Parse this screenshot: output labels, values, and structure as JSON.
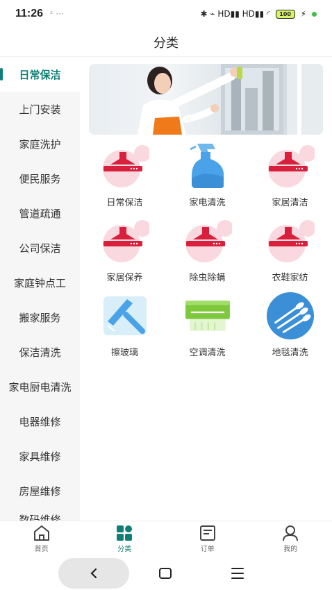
{
  "status_bar": {
    "time": "11:26",
    "extra": "ᶻ ···",
    "signal_text": "✱ ⌁ HD▮▮ HD▮▮ ◜",
    "battery": "100",
    "charging": "⚡"
  },
  "header": {
    "title": "分类"
  },
  "sidebar": {
    "items": [
      {
        "label": "日常保洁",
        "active": true
      },
      {
        "label": "上门安装"
      },
      {
        "label": "家庭洗护"
      },
      {
        "label": "便民服务"
      },
      {
        "label": "管道疏通"
      },
      {
        "label": "公司保洁"
      },
      {
        "label": "家庭钟点工"
      },
      {
        "label": "搬家服务"
      },
      {
        "label": "保洁清洗"
      },
      {
        "label": "家电厨电清洗"
      },
      {
        "label": "电器维修"
      },
      {
        "label": "家具维修"
      },
      {
        "label": "房屋维修"
      },
      {
        "label": "数码维修"
      }
    ]
  },
  "services": [
    {
      "label": "日常保洁",
      "icon": "range-hood-icon"
    },
    {
      "label": "家电清洗",
      "icon": "spray-bottle-icon"
    },
    {
      "label": "家居清洁",
      "icon": "range-hood-icon"
    },
    {
      "label": "家居保养",
      "icon": "range-hood-icon"
    },
    {
      "label": "除虫除螨",
      "icon": "range-hood-icon"
    },
    {
      "label": "衣鞋家纺",
      "icon": "range-hood-icon"
    },
    {
      "label": "擦玻璃",
      "icon": "squeegee-icon"
    },
    {
      "label": "空调清洗",
      "icon": "air-conditioner-icon"
    },
    {
      "label": "地毯清洗",
      "icon": "cotton-swab-icon"
    }
  ],
  "bottom_nav": [
    {
      "label": "首页",
      "icon": "home-icon"
    },
    {
      "label": "分类",
      "icon": "category-icon",
      "active": true
    },
    {
      "label": "订单",
      "icon": "order-icon"
    },
    {
      "label": "我的",
      "icon": "user-icon"
    }
  ],
  "colors": {
    "accent": "#0f7f76",
    "icon_red": "#d8203c",
    "icon_pink": "#f9d9df",
    "icon_blue": "#4aa3e8"
  }
}
